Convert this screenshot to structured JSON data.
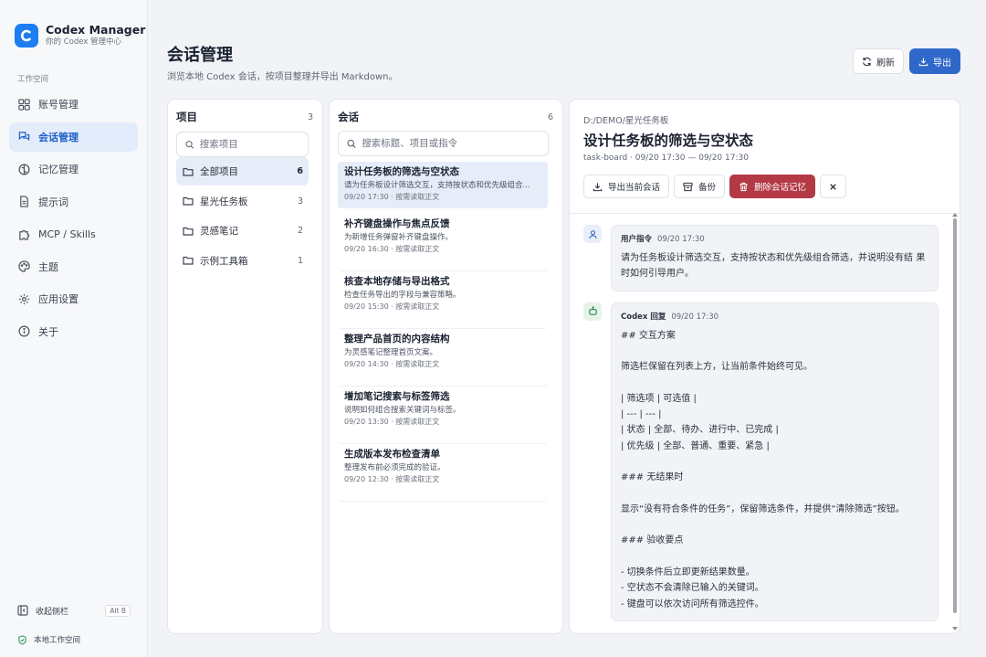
{
  "brand": {
    "title": "Codex Manager",
    "subtitle": "你的 Codex 管理中心",
    "accent": "#1d7ef2"
  },
  "sidebar": {
    "section_label": "工作空间",
    "items": [
      {
        "label": "账号管理",
        "icon": "grid-icon",
        "active": false
      },
      {
        "label": "会话管理",
        "icon": "chat-icon",
        "active": true
      },
      {
        "label": "记忆管理",
        "icon": "brain-icon",
        "active": false
      },
      {
        "label": "提示词",
        "icon": "document-icon",
        "active": false
      },
      {
        "label": "MCP / Skills",
        "icon": "puzzle-icon",
        "active": false
      },
      {
        "label": "主题",
        "icon": "palette-icon",
        "active": false
      },
      {
        "label": "应用设置",
        "icon": "gear-icon",
        "active": false
      },
      {
        "label": "关于",
        "icon": "info-icon",
        "active": false
      }
    ],
    "collapse_label": "收起侧栏",
    "collapse_shortcut": "Alt B",
    "workspace_label": "本地工作空间"
  },
  "header": {
    "title": "会话管理",
    "subtitle": "浏览本地 Codex 会话，按项目整理并导出 Markdown。",
    "refresh_label": "刷新",
    "export_label": "导出",
    "primary_color": "#2f68c9"
  },
  "projects": {
    "title": "项目",
    "count": "3",
    "search_placeholder": "搜索项目",
    "items": [
      {
        "name": "全部项目",
        "count": "6",
        "active": true
      },
      {
        "name": "星光任务板",
        "count": "3",
        "active": false
      },
      {
        "name": "灵感笔记",
        "count": "2",
        "active": false
      },
      {
        "name": "示例工具箱",
        "count": "1",
        "active": false
      }
    ]
  },
  "sessions": {
    "title": "会话",
    "count": "6",
    "search_placeholder": "搜索标题、项目或指令",
    "items": [
      {
        "title": "设计任务板的筛选与空状态",
        "desc": "请为任务板设计筛选交互，支持按状态和优先级组合...",
        "meta": "09/20 17:30 · 按需读取正文",
        "active": true
      },
      {
        "title": "补齐键盘操作与焦点反馈",
        "desc": "为新增任务弹窗补齐键盘操作。",
        "meta": "09/20 16:30 · 按需读取正文",
        "active": false
      },
      {
        "title": "核查本地存储与导出格式",
        "desc": "检查任务导出的字段与兼容策略。",
        "meta": "09/20 15:30 · 按需读取正文",
        "active": false
      },
      {
        "title": "整理产品首页的内容结构",
        "desc": "为灵感笔记整理首页文案。",
        "meta": "09/20 14:30 · 按需读取正文",
        "active": false
      },
      {
        "title": "增加笔记搜索与标签筛选",
        "desc": "说明如何组合搜索关键词与标签。",
        "meta": "09/20 13:30 · 按需读取正文",
        "active": false
      },
      {
        "title": "生成版本发布检查清单",
        "desc": "整理发布前必须完成的验证。",
        "meta": "09/20 12:30 · 按需读取正文",
        "active": false
      }
    ]
  },
  "detail": {
    "path": "D:/DEMO/星光任务板",
    "title": "设计任务板的筛选与空状态",
    "meta": "task-board · 09/20 17:30 — 09/20 17:30",
    "actions": {
      "export_current": "导出当前会话",
      "backup": "备份",
      "delete_memory": "删除会话记忆"
    },
    "danger_color": "#b33a45",
    "messages": [
      {
        "role": "user",
        "author": "用户指令",
        "time": "09/20 17:30",
        "lines": [
          "请为任务板设计筛选交互，支持按状态和优先级组合筛选，并说明没有结",
          "果时如何引导用户。"
        ]
      },
      {
        "role": "assistant",
        "author": "Codex 回复",
        "time": "09/20 17:30",
        "lines": [
          "## 交互方案",
          "",
          "筛选栏保留在列表上方，让当前条件始终可见。",
          "",
          "| 筛选项 | 可选值 |",
          "| --- | --- |",
          "| 状态 | 全部、待办、进行中、已完成 |",
          "| 优先级 | 全部、普通、重要、紧急 |",
          "",
          "### 无结果时",
          "",
          "显示“没有符合条件的任务”，保留筛选条件，并提供“清除筛选”按钮。",
          "",
          "### 验收要点",
          "",
          "- 切换条件后立即更新结果数量。",
          "- 空状态不会清除已输入的关键词。",
          "- 键盘可以依次访问所有筛选控件。"
        ]
      }
    ]
  }
}
